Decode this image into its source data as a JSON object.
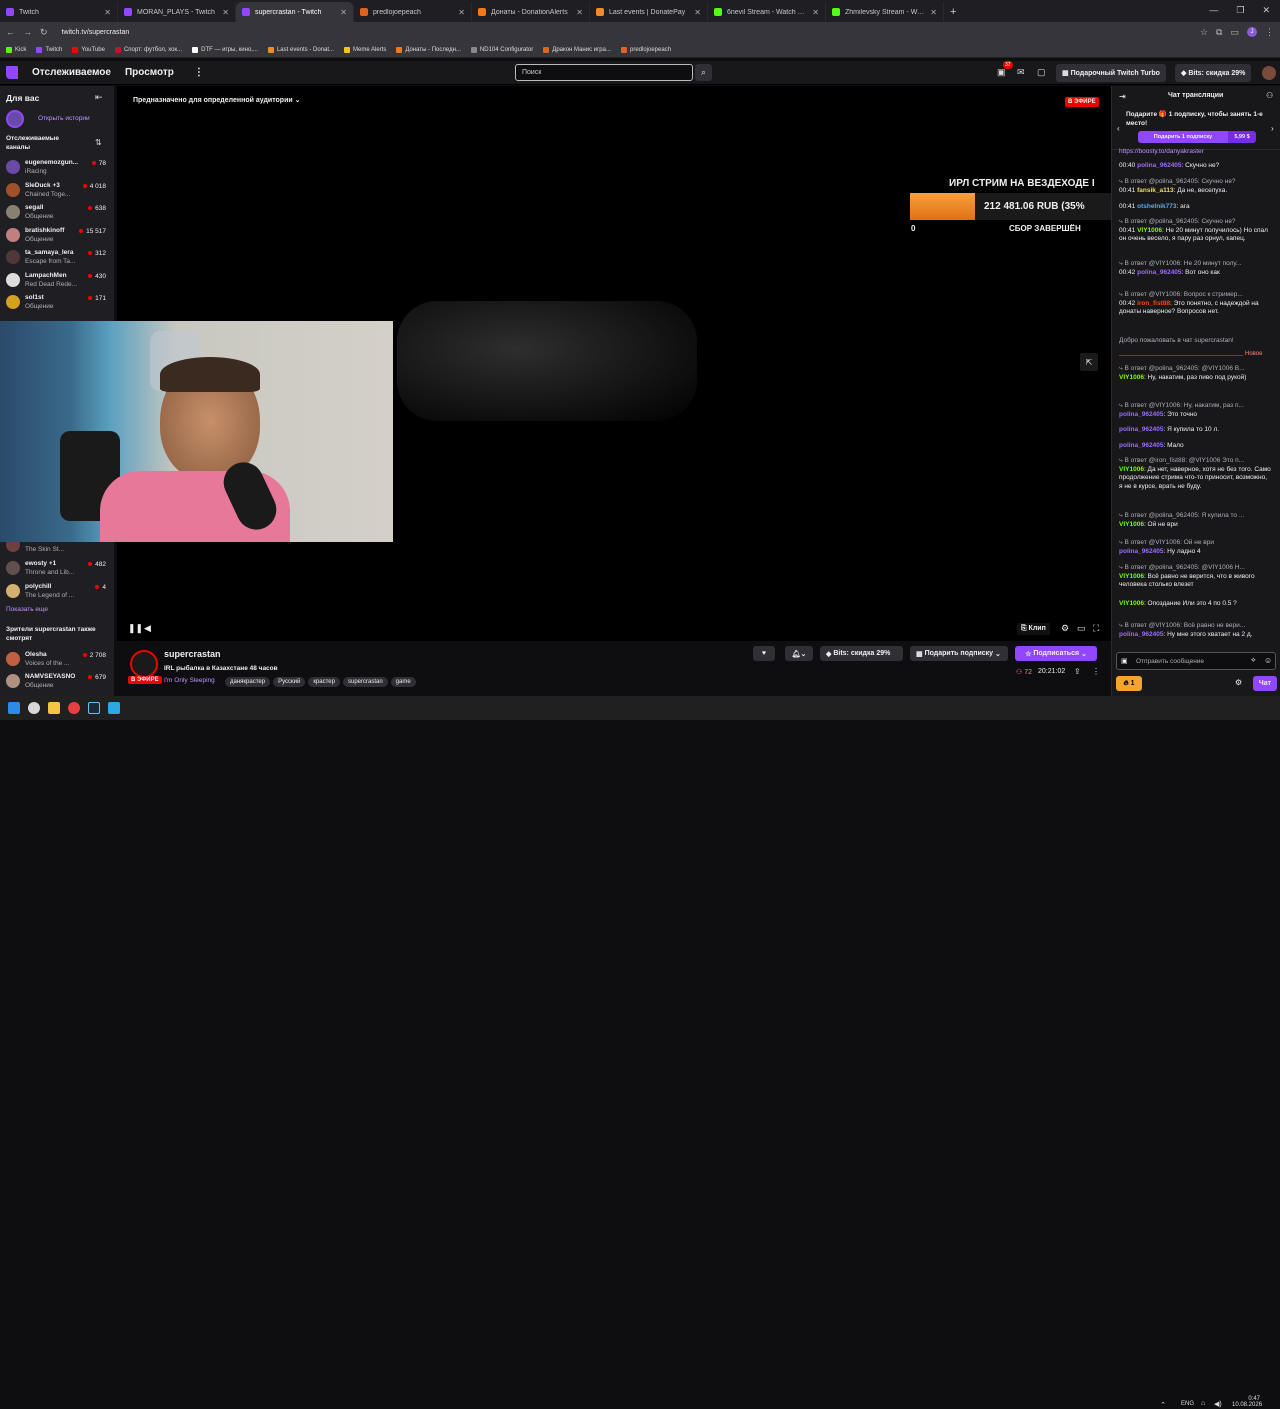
{
  "browser": {
    "tabs": [
      {
        "title": "Twitch",
        "color": "#9147ff",
        "active": false
      },
      {
        "title": "MORAN_PLAYS - Twitch",
        "color": "#9147ff",
        "active": false
      },
      {
        "title": "supercrastan - Twitch",
        "color": "#9147ff",
        "active": true
      },
      {
        "title": "predlojoepeach",
        "color": "#e0641e",
        "active": false
      },
      {
        "title": "Донаты - DonationAlerts",
        "color": "#f0781e",
        "active": false
      },
      {
        "title": "Last events | DonatePay",
        "color": "#f08c28",
        "active": false
      },
      {
        "title": "6nevil Stream - Watch Live on K",
        "color": "#53fc18",
        "active": false
      },
      {
        "title": "Zhmilevsky Stream - Watch Live",
        "color": "#53fc18",
        "active": false
      }
    ],
    "url": "twitch.tv/supercrastan",
    "profile_initial": "J",
    "bookmarks": [
      {
        "label": "Kick",
        "color": "#53fc18"
      },
      {
        "label": "Twitch",
        "color": "#9147ff"
      },
      {
        "label": "YouTube",
        "color": "#ff0000"
      },
      {
        "label": "Спорт: футбол, хок...",
        "color": "#c8102e"
      },
      {
        "label": "DTF — игры, кино,...",
        "color": "#ffffff"
      },
      {
        "label": "Last events - Donat...",
        "color": "#f08c28"
      },
      {
        "label": "Meme Alerts",
        "color": "#f5c518"
      },
      {
        "label": "Донаты - Последн...",
        "color": "#f0781e"
      },
      {
        "label": "ND104 Configurator",
        "color": "#888888"
      },
      {
        "label": "Дракон Манис игра...",
        "color": "#e0641e"
      },
      {
        "label": "predlojoepeach",
        "color": "#e0641e"
      }
    ]
  },
  "topnav": {
    "following": "Отслеживаемое",
    "browse": "Просмотр",
    "more": "⋮",
    "search_placeholder": "Поиск",
    "notif_count": "37",
    "turbo_label": "Подарочный Twitch Turbo",
    "bits_label": "Bits: скидка 29%"
  },
  "sidebar": {
    "title": "Для вас",
    "stories_label": "Открыть истории",
    "followed_title": "Отслеживаемые каналы",
    "channels": [
      {
        "name": "eugenemozgun...",
        "game": "iRacing",
        "viewers": "78",
        "color": "#6a4aa8"
      },
      {
        "name": "SleDuck +3",
        "game": "Chained Toge...",
        "viewers": "4 018",
        "color": "#a0502a"
      },
      {
        "name": "segall",
        "game": "Общение",
        "viewers": "638",
        "color": "#888070"
      },
      {
        "name": "bratishkinoff",
        "game": "Общение",
        "viewers": "15 517",
        "color": "#c08080"
      },
      {
        "name": "ta_samaya_lera",
        "game": "Escape from Ta...",
        "viewers": "312",
        "color": "#503838"
      },
      {
        "name": "LampachMen",
        "game": "Red Dead Rede...",
        "viewers": "430",
        "color": "#dcdcdc"
      },
      {
        "name": "sol1st",
        "game": "Общение",
        "viewers": "171",
        "color": "#d4a020"
      }
    ],
    "channels_lower": [
      {
        "name": "",
        "game": "The Skin St...",
        "viewers": "",
        "color": "#704040"
      },
      {
        "name": "ewosty +1",
        "game": "Throne and Lib...",
        "viewers": "482",
        "color": "#605050"
      },
      {
        "name": "polychill",
        "game": "The Legend of ...",
        "viewers": "4",
        "color": "#d4b070"
      }
    ],
    "show_more": "Показать еще",
    "also_watch_title": "Зрители supercrastan также смотрят",
    "also_watch": [
      {
        "name": "Olesha",
        "game": "Voices of the ...",
        "viewers": "2 708",
        "color": "#c06040"
      },
      {
        "name": "NAMVSEYASNO",
        "game": "Общение",
        "viewers": "679",
        "color": "#b09080"
      }
    ]
  },
  "player": {
    "audience_label": "Предназначено для определенной аудитории",
    "live_badge": "В ЭФИРЕ",
    "donation_title": "ИРЛ СТРИМ НА ВЕЗДЕХОДЕ I",
    "donation_amount": "212 481.06 RUB (35%",
    "donation_progress": 0.35,
    "donation_min": "0",
    "donation_status": "СБОР ЗАВЕРШЁН",
    "clip_label": "Клип"
  },
  "stream_info": {
    "channel": "supercrastan",
    "title": "IRL рыбалка в Казахстане 48 часов",
    "category": "I'm Only Sleeping",
    "live_label": "В ЭФИРЕ",
    "tags": [
      "данякрастер",
      "Русский",
      "крастер",
      "supercrastan",
      "game"
    ],
    "bits_label": "Bits: скидка 29%",
    "gift_label": "Подарить подписку",
    "subscribe_label": "Подписаться",
    "viewers": "72",
    "uptime": "20:21:02"
  },
  "chat": {
    "header": "Чат трансляции",
    "gift_promo": "Подарите 🎁 1 подписку, чтобы занять 1-е место!",
    "gift_button": "Подарить 1 подписку",
    "gift_price": "5,99 $",
    "new_label": "Новое",
    "input_placeholder": "Отправить сообщение",
    "points": "1",
    "chat_button": "Чат",
    "welcome": "Добро пожаловать в чат supercrastan!",
    "messages": [
      {
        "text": "https://boosty.to/danyakraster",
        "color": "#bf94ff"
      },
      {
        "time": "00:40",
        "user": "polina_962405",
        "text": ": Скучно не?",
        "color": "#9b6bff"
      },
      {
        "reply": "В ответ @polina_962405: Скучно не?",
        "time": "00:41",
        "user": "fansik_a113",
        "text": ": Да не, веселуха.",
        "color": "#e8e05a"
      },
      {
        "time": "00:41",
        "user": "otshelnik773",
        "text": ": ага",
        "color": "#5aa8e8"
      },
      {
        "reply": "В ответ @polina_962405: Скучно не?",
        "time": "00:41",
        "user": "VIY1006",
        "text": ": Не 20 минут получилось) Но спал он очень весело, я пару раз орнул, капец.",
        "color": "#7cfc00"
      },
      {
        "reply": "В ответ @VIY1006: Не 20 минут полу...",
        "time": "00:42",
        "user": "polina_962405",
        "text": ": Вот оно как",
        "color": "#9b6bff"
      },
      {
        "reply": "В ответ @VIY1006: Вопрос к стример...",
        "time": "00:42",
        "user": "iron_fist88",
        "text": ": Это понятно, с надеждой на донаты наверное? Вопросов нет.",
        "color": "#ff4500"
      },
      {
        "reply": "В ответ @polina_962405: @VIY1006 В...",
        "user": "VIY1006",
        "text": ": Ну, накатим, раз пиво под рукой)",
        "color": "#7cfc00"
      },
      {
        "reply": "В ответ @VIY1006: Ну, накатим, раз п...",
        "user": "polina_962405",
        "text": ": Это точно",
        "color": "#9b6bff"
      },
      {
        "user": "polina_962405",
        "text": ": Я купила то 10 л.",
        "color": "#9b6bff"
      },
      {
        "user": "polina_962405",
        "text": ": Мало",
        "color": "#9b6bff"
      },
      {
        "reply": "В ответ @iron_fist88: @VIY1006 Это п...",
        "user": "VIY1006",
        "text": ": Да нет, наверное, хотя не без того. Само продолжение стрима что-то приносит, возможно, я не в курсе, врать не буду.",
        "color": "#7cfc00"
      },
      {
        "reply": "В ответ @polina_962405: Я купила то ...",
        "user": "VIY1006",
        "text": ": Ой не ври",
        "color": "#7cfc00"
      },
      {
        "reply": "В ответ @VIY1006: Ой не ври",
        "user": "polina_962405",
        "text": ": Ну ладно 4",
        "color": "#9b6bff"
      },
      {
        "reply": "В ответ @polina_962405: @VIY1006 Н...",
        "user": "VIY1006",
        "text": ": Всё равно не верится, что в живого человека столько влезет",
        "color": "#7cfc00"
      },
      {
        "user": "VIY1006",
        "text": ": Опоздание Или это 4 по 0.5 ?",
        "color": "#7cfc00"
      },
      {
        "reply": "В ответ @VIY1006: Всё равно не вери...",
        "user": "polina_962405",
        "text": ": Ну мне этого хватает на 2 д.",
        "color": "#9b6bff"
      }
    ]
  },
  "taskbar": {
    "lang": "ENG",
    "time": "0:47",
    "date": "10.08.2026"
  }
}
